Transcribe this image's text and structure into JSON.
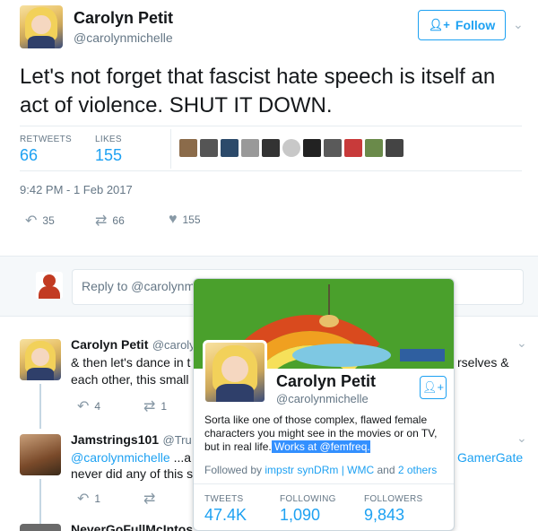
{
  "tweet": {
    "author_name": "Carolyn Petit",
    "author_handle": "@carolynmichelle",
    "follow_label": "Follow",
    "text": "Let's not forget that fascist hate speech is itself an act of violence. SHUT IT DOWN.",
    "retweets_label": "RETWEETS",
    "retweets": "66",
    "likes_label": "LIKES",
    "likes": "155",
    "timestamp": "9:42 PM - 1 Feb 2017",
    "action_reply_count": "35",
    "action_retweet_count": "66",
    "action_like_count": "155"
  },
  "reply_box": {
    "placeholder": "Reply to @carolynm"
  },
  "replies": [
    {
      "name": "Carolyn Petit",
      "handle": "@caroly",
      "text_line1": "& then let's dance in t",
      "text_line1_right": "rselves &",
      "text_line2": "each other, this small",
      "reply_count": "4",
      "retweet_count": "1"
    },
    {
      "name": "Jamstrings101",
      "handle": "@Tru",
      "mention": "@carolynmichelle",
      "text_line1_rest": " ...a",
      "text_line1_right": "GamerGate",
      "text_line2": "never did any of this s",
      "reply_count": "1"
    },
    {
      "name": "NeverGoFullMcIntos"
    }
  ],
  "hover_card": {
    "name": "Carolyn Petit",
    "handle": "@carolynmichelle",
    "bio_line1": "Sorta like one of those complex, flawed female",
    "bio_line2": "characters you might see in the movies or on TV,",
    "bio_line3_pre": "but in real life.",
    "bio_highlight_pre": " Works at ",
    "bio_highlight_link": "@femfreq",
    "bio_highlight_post": ".",
    "followed_by_prefix": "Followed by ",
    "followed_by_names": "impstr synDRm | WMC",
    "followed_by_and": " and ",
    "followed_by_others": "2 others",
    "tweets_label": "TWEETS",
    "tweets": "47.4K",
    "following_label": "FOLLOWING",
    "following": "1,090",
    "followers_label": "FOLLOWERS",
    "followers": "9,843"
  },
  "colors": {
    "accent": "#1da1f2",
    "text": "#14171a",
    "muted": "#657786"
  }
}
